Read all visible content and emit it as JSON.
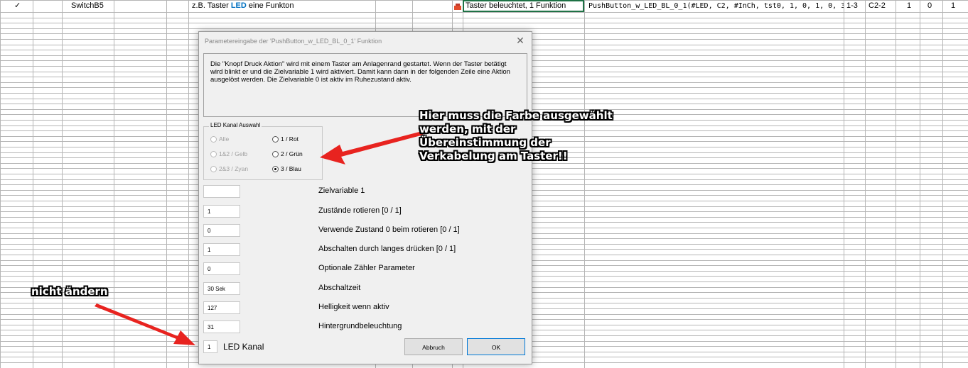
{
  "row1": {
    "check": "✓",
    "name": "SwitchB5",
    "desc_prefix": "z.B. Taster ",
    "desc_led": "LED",
    "desc_suffix": " eine Funkton",
    "macro_desc": "Taster beleuchtet, 1 Funktion",
    "macro_code": "PushButton_w_LED_BL_0_1(#LED, C2, #InCh, tst0, 1, 0, 1, 0, 3",
    "range": "1-3",
    "channel": "C2-2",
    "v1": "1",
    "v2": "0",
    "v3": "1"
  },
  "dialog": {
    "title": "Parametereingabe der 'PushButton_w_LED_BL_0_1' Funktion",
    "close": "✕",
    "description": "Die \"Knopf Druck Aktion\" wird mit einem Taster am Anlagenrand gestartet. Wenn der Taster betätigt wird blinkt er und die Zielvariable 1 wird aktiviert. Damit kann dann in der folgenden Zeile eine Aktion ausgelöst werden. Die Zielvariable 0 ist aktiv im Ruhezustand aktiv.",
    "led_group_label": "LED Kanal Auswahl",
    "radios": {
      "alle": "Alle",
      "rot": "1 / Rot",
      "gelb": "1&2 / Gelb",
      "gruen": "2 / Grün",
      "cyan": "2&3 / Zyan",
      "blau": "3 / Blau"
    },
    "selected_radio": "3 / Blau",
    "fields": [
      {
        "value": "",
        "label": "Zielvariable 1"
      },
      {
        "value": "1",
        "label": "Zustände rotieren [0 / 1]"
      },
      {
        "value": "0",
        "label": "Verwende Zustand 0 beim rotieren [0 / 1]"
      },
      {
        "value": "1",
        "label": "Abschalten durch langes drücken  [0 / 1]"
      },
      {
        "value": "0",
        "label": "Optionale Zähler Parameter"
      },
      {
        "value": "30 Sek",
        "label": "Abschaltzeit"
      },
      {
        "value": "127",
        "label": "Helligkeit wenn aktiv"
      },
      {
        "value": "31",
        "label": "Hintergrundbeleuchtung"
      }
    ],
    "led_channel_value": "1",
    "led_channel_label": "LED Kanal",
    "cancel_label": "Abbruch",
    "ok_label": "OK"
  },
  "annotations": {
    "top_callout": [
      "Hier muss die Farbe ausgewählt",
      "werden, mit der",
      "Übereinstimmung der",
      "Verkabelung am Taster!!"
    ],
    "bottom_callout": "nicht ändern"
  },
  "colors": {
    "grid": "#b5b5b5",
    "led_text": "#0070c0",
    "arrow": "#e8231f",
    "selected_cell": "#1e7145"
  }
}
